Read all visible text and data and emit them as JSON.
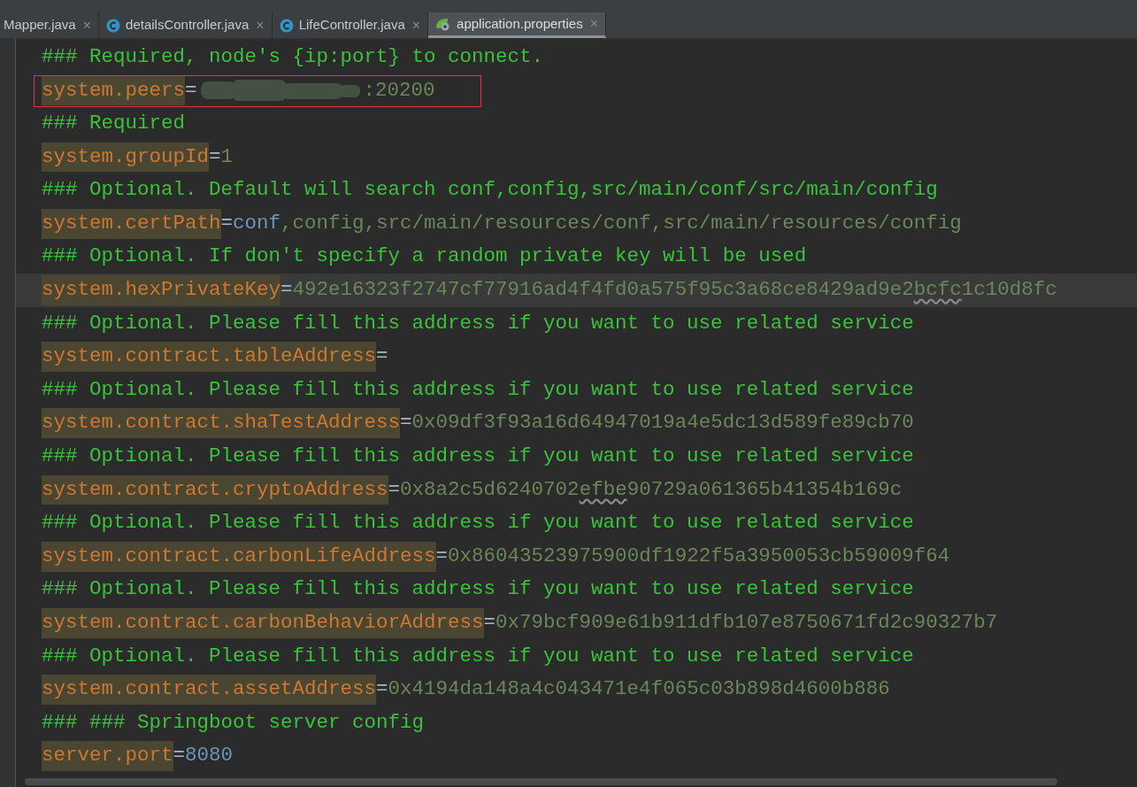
{
  "tabs": [
    {
      "label": "Mapper.java",
      "kind": "plain",
      "close": "×",
      "selected": false
    },
    {
      "label": "detailsController.java",
      "kind": "class",
      "close": "×",
      "selected": false
    },
    {
      "label": "LifeController.java",
      "kind": "class",
      "close": "×",
      "selected": false
    },
    {
      "label": "application.properties",
      "kind": "properties",
      "close": "×",
      "selected": true
    }
  ],
  "lines": [
    {
      "kind": "comment",
      "text": "### Required, node's {ip:port} to connect.",
      "current": false,
      "outlined": false
    },
    {
      "kind": "property",
      "key": "system.peers",
      "separator": "=",
      "redacted": true,
      "value": [
        {
          "kind": "string",
          "text": ":20200"
        }
      ],
      "current": false,
      "outlined": true
    },
    {
      "kind": "comment",
      "text": "### Required",
      "current": false,
      "outlined": false
    },
    {
      "kind": "property",
      "key": "system.groupId",
      "separator": "=",
      "redacted": false,
      "value": [
        {
          "kind": "string",
          "text": "1"
        }
      ],
      "current": false,
      "outlined": false
    },
    {
      "kind": "comment",
      "text": "### Optional. Default will search conf,config,src/main/conf/src/main/config",
      "current": false,
      "outlined": false
    },
    {
      "kind": "property",
      "key": "system.certPath",
      "separator": "=",
      "redacted": false,
      "value": [
        {
          "kind": "keyword",
          "text": "conf"
        },
        {
          "kind": "string",
          "text": ",config,src/main/resources/conf,src/main/resources/config"
        }
      ],
      "current": false,
      "outlined": false
    },
    {
      "kind": "comment",
      "text": "### Optional. If don't specify a random private key will be used",
      "current": false,
      "outlined": false
    },
    {
      "kind": "property",
      "key": "system.hexPrivateKey",
      "separator": "=",
      "redacted": false,
      "value": [
        {
          "kind": "string",
          "text": "492e16323f2747cf77916ad4f4fd0a575f95c3a68ce8429ad9e2"
        },
        {
          "kind": "typo",
          "text": "bcfc"
        },
        {
          "kind": "string",
          "text": "1c10d8fc"
        }
      ],
      "current": true,
      "outlined": false
    },
    {
      "kind": "comment",
      "text": "### Optional. Please fill this address if you want to use related service",
      "current": false,
      "outlined": false
    },
    {
      "kind": "property",
      "key": "system.contract.tableAddress",
      "separator": "=",
      "redacted": false,
      "current": false,
      "outlined": false
    },
    {
      "kind": "comment",
      "text": "### Optional. Please fill this address if you want to use related service",
      "current": false,
      "outlined": false
    },
    {
      "kind": "property",
      "key": "system.contract.shaTestAddress",
      "separator": "=",
      "redacted": false,
      "value": [
        {
          "kind": "string",
          "text": "0x09df3f93a16d64947019a4e5dc13d589fe89cb70"
        }
      ],
      "current": false,
      "outlined": false
    },
    {
      "kind": "comment",
      "text": "### Optional. Please fill this address if you want to use related service",
      "current": false,
      "outlined": false
    },
    {
      "kind": "property",
      "key": "system.contract.cryptoAddress",
      "separator": "=",
      "redacted": false,
      "value": [
        {
          "kind": "string",
          "text": "0x8a2c5d6240702"
        },
        {
          "kind": "typo",
          "text": "efbe"
        },
        {
          "kind": "string",
          "text": "90729a061365b41354b169c"
        }
      ],
      "current": false,
      "outlined": false
    },
    {
      "kind": "comment",
      "text": "### Optional. Please fill this address if you want to use related service",
      "current": false,
      "outlined": false
    },
    {
      "kind": "property",
      "key": "system.contract.carbonLifeAddress",
      "separator": "=",
      "redacted": false,
      "value": [
        {
          "kind": "string",
          "text": "0x86043523975900df1922f5a3950053cb59009f64"
        }
      ],
      "current": false,
      "outlined": false
    },
    {
      "kind": "comment",
      "text": "### Optional. Please fill this address if you want to use related service",
      "current": false,
      "outlined": false
    },
    {
      "kind": "property",
      "key": "system.contract.carbonBehaviorAddress",
      "separator": "=",
      "redacted": false,
      "value": [
        {
          "kind": "string",
          "text": "0x79bcf909e61b911dfb107e8750671fd2c90327b7"
        }
      ],
      "current": false,
      "outlined": false
    },
    {
      "kind": "comment",
      "text": "### Optional. Please fill this address if you want to use related service",
      "current": false,
      "outlined": false
    },
    {
      "kind": "property",
      "key": "system.contract.assetAddress",
      "separator": "=",
      "redacted": false,
      "value": [
        {
          "kind": "string",
          "text": "0x4194da148a4c043471e4f065c03b898d4600b886"
        }
      ],
      "current": false,
      "outlined": false
    },
    {
      "kind": "comment",
      "text": "### ### Springboot server config",
      "current": false,
      "outlined": false
    },
    {
      "kind": "property",
      "key": "server.port",
      "separator": "=",
      "redacted": false,
      "value": [
        {
          "kind": "keyword",
          "text": "8080"
        }
      ],
      "current": false,
      "outlined": false
    }
  ]
}
